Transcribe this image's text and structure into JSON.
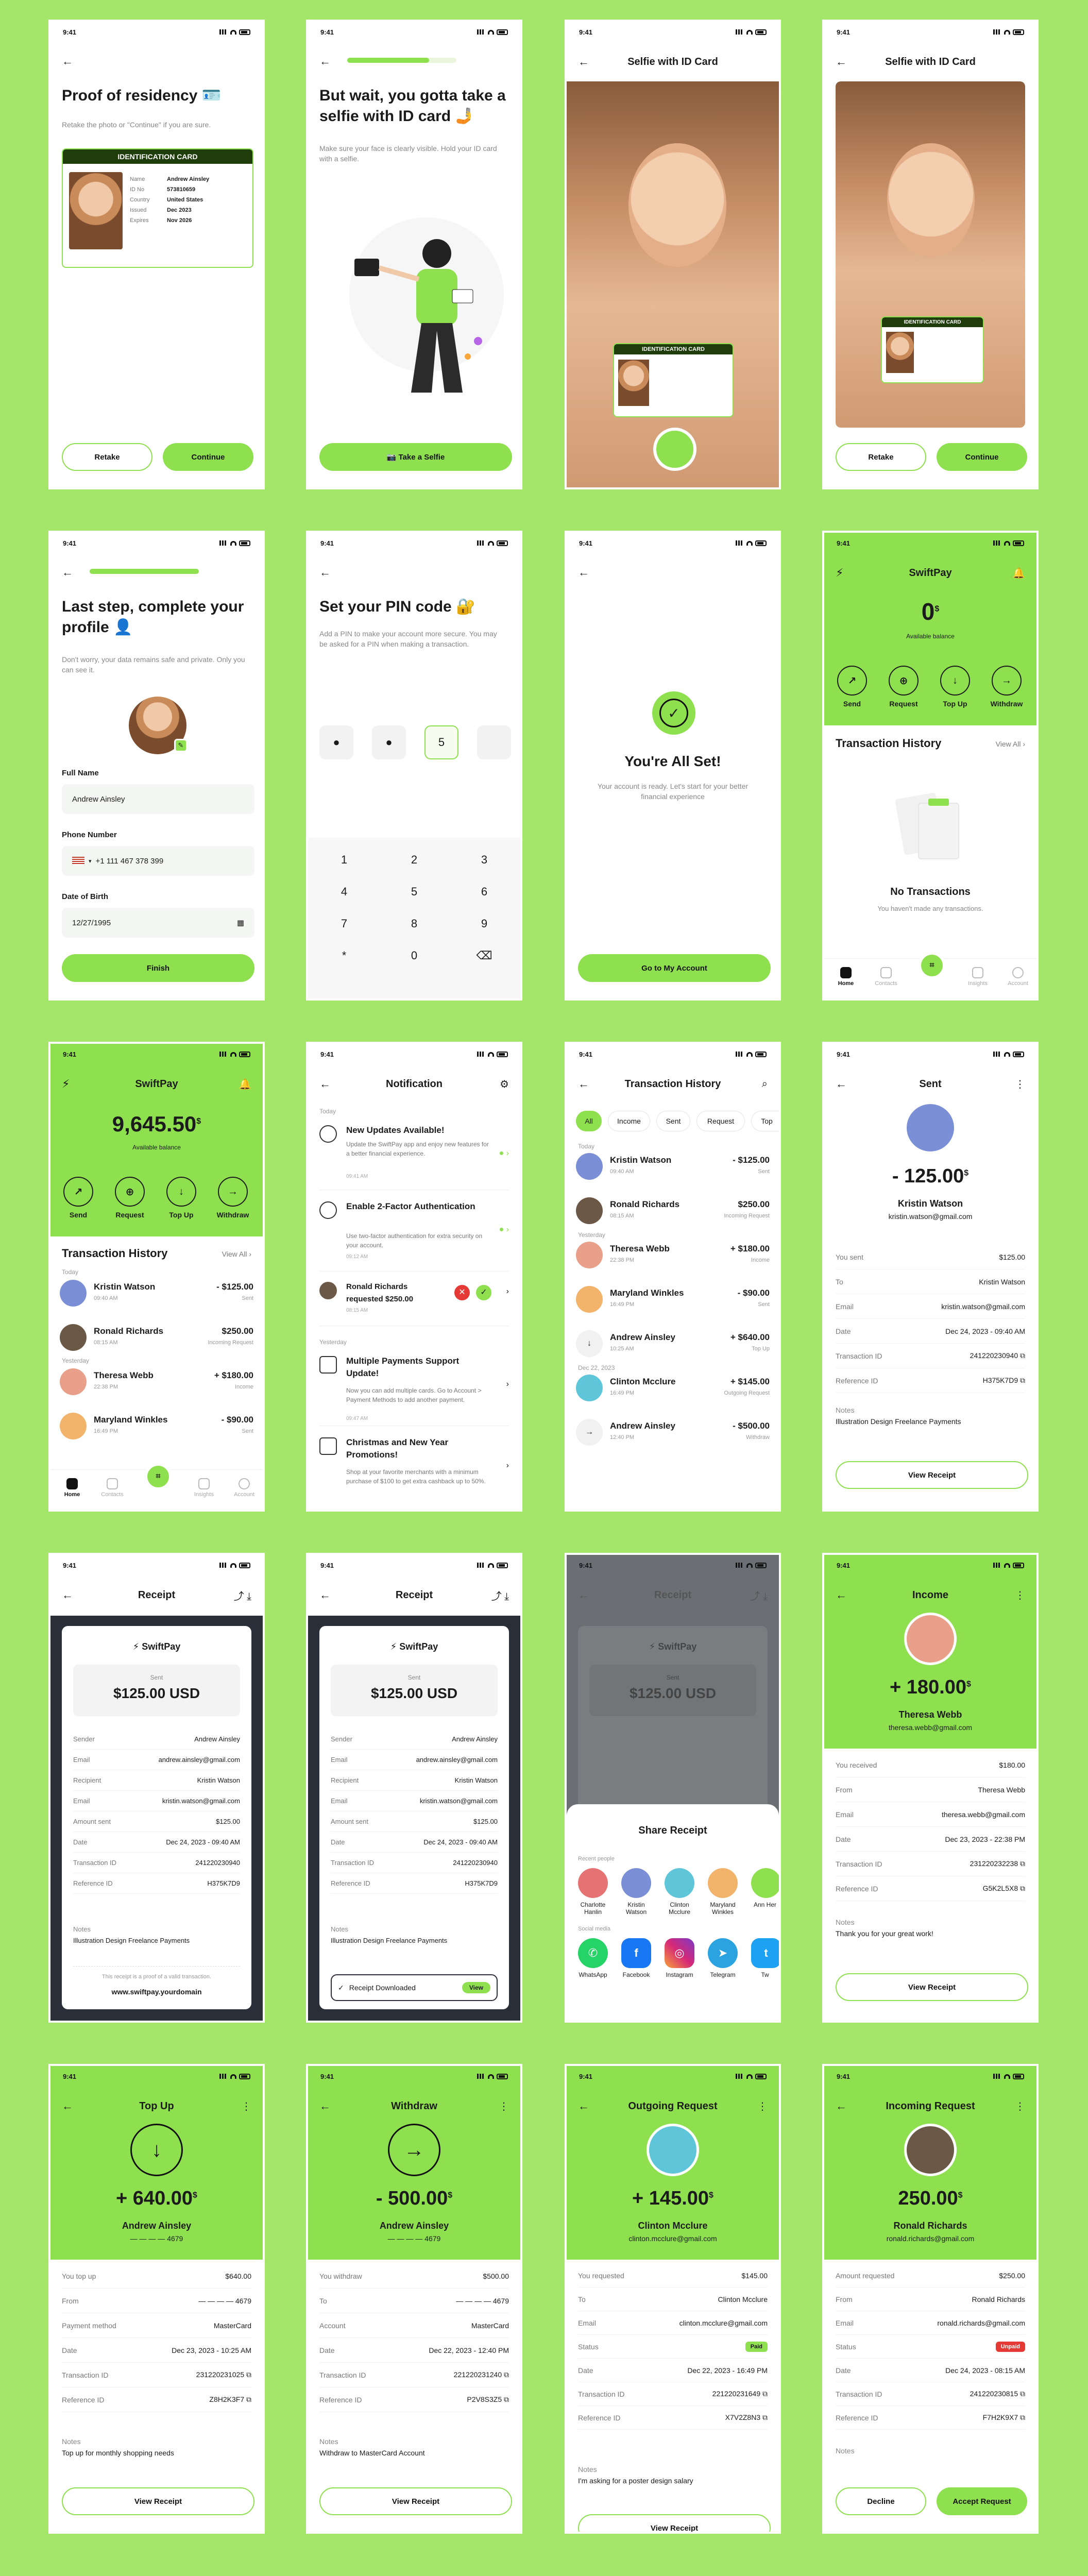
{
  "status_time": "9:41",
  "s1": {
    "title": "Proof of residency 🪪",
    "sub": "Retake the photo or \"Continue\" if you are sure.",
    "card_title": "IDENTIFICATION CARD",
    "rows": [
      [
        "Name",
        "Andrew Ainsley"
      ],
      [
        "ID No",
        "573810659"
      ],
      [
        "Country",
        "United States"
      ],
      [
        "Issued",
        "Dec 2023"
      ],
      [
        "Expires",
        "Nov 2026"
      ]
    ],
    "retake": "Retake",
    "continue": "Continue"
  },
  "s2": {
    "title": "But wait, you gotta take a selfie with ID card 🤳",
    "sub": "Make sure your face is clearly visible. Hold your ID card with a selfie.",
    "btn": "📷  Take a Selfie"
  },
  "s3": {
    "title": "Selfie with ID Card",
    "card_title": "IDENTIFICATION CARD"
  },
  "s4": {
    "title": "Selfie with ID Card",
    "card_title": "IDENTIFICATION CARD",
    "retake": "Retake",
    "continue": "Continue"
  },
  "s5": {
    "title": "Last step, complete your profile 👤",
    "sub": "Don't worry, your data remains safe and private. Only you can see it.",
    "l_name": "Full Name",
    "v_name": "Andrew Ainsley",
    "l_phone": "Phone Number",
    "v_phone": "+1 111 467 378 399",
    "l_dob": "Date of Birth",
    "v_dob": "12/27/1995",
    "btn": "Finish"
  },
  "s6": {
    "title": "Set your PIN code 🔐",
    "sub": "Add a PIN to make your account more secure. You may be asked for a PIN when making a transaction.",
    "pins": [
      "●",
      "●",
      "5",
      ""
    ],
    "keys": [
      "1",
      "2",
      "3",
      "4",
      "5",
      "6",
      "7",
      "8",
      "9",
      "*",
      "0",
      "⌫"
    ]
  },
  "s7": {
    "title": "You're All Set!",
    "sub": "Your account is ready. Let's start for your better financial experience",
    "btn": "Go to My Account"
  },
  "s8": {
    "app": "SwiftPay",
    "balance": "0",
    "currency": "$",
    "bal_label": "Available balance",
    "actions": [
      "Send",
      "Request",
      "Top Up",
      "Withdraw"
    ],
    "section": "Transaction History",
    "view_all": "View All",
    "empty_title": "No Transactions",
    "empty_sub": "You haven't made any transactions.",
    "nav": [
      "Home",
      "Contacts",
      "",
      "Insights",
      "Account"
    ]
  },
  "s9": {
    "app": "SwiftPay",
    "balance": "9,645.50",
    "currency": "$",
    "bal_label": "Available balance",
    "actions": [
      "Send",
      "Request",
      "Top Up",
      "Withdraw"
    ],
    "section": "Transaction History",
    "view_all": "View All",
    "today": "Today",
    "yesterday": "Yesterday",
    "tx": [
      {
        "n": "Kristin Watson",
        "d": "09:40 AM",
        "a": "- $125.00",
        "s": "Sent"
      },
      {
        "n": "Ronald Richards",
        "d": "08:15 AM",
        "a": "$250.00",
        "s": "Incoming Request"
      },
      {
        "n": "Theresa Webb",
        "d": "22:38 PM",
        "a": "+ $180.00",
        "s": "Income"
      },
      {
        "n": "Maryland Winkles",
        "d": "16:49 PM",
        "a": "- $90.00",
        "s": "Sent"
      }
    ],
    "nav": [
      "Home",
      "Contacts",
      "",
      "Insights",
      "Account"
    ]
  },
  "s10": {
    "title": "Notification",
    "today": "Today",
    "yesterday": "Yesterday",
    "items": [
      {
        "t": "New Updates Available!",
        "b": "Update the SwiftPay app and enjoy new features for a better financial experience.",
        "d": "09:41 AM"
      },
      {
        "t": "Enable 2-Factor Authentication",
        "b": "Use two-factor authentication for extra security on your account.",
        "d": "09:12 AM"
      },
      {
        "t": "Ronald Richards requested $250.00",
        "b": "",
        "d": "08:15 AM"
      },
      {
        "t": "Multiple Payments Support Update!",
        "b": "Now you can add multiple cards. Go to Account > Payment Methods to add another payment.",
        "d": "09:47 AM"
      },
      {
        "t": "Christmas and New Year Promotions!",
        "b": "Shop at your favorite merchants with a minimum purchase of $100 to get extra cashback up to 50%.",
        "d": ""
      }
    ]
  },
  "s11": {
    "title": "Transaction History",
    "chips": [
      "All",
      "Income",
      "Sent",
      "Request",
      "Top"
    ],
    "today": "Today",
    "yesterday": "Yesterday",
    "dec22": "Dec 22, 2023",
    "tx": [
      {
        "n": "Kristin Watson",
        "d": "09:40 AM",
        "a": "- $125.00",
        "s": "Sent"
      },
      {
        "n": "Ronald Richards",
        "d": "08:15 AM",
        "a": "$250.00",
        "s": "Incoming Request"
      },
      {
        "n": "Theresa Webb",
        "d": "22:38 PM",
        "a": "+ $180.00",
        "s": "Income"
      },
      {
        "n": "Maryland Winkles",
        "d": "16:49 PM",
        "a": "- $90.00",
        "s": "Sent"
      },
      {
        "n": "Andrew Ainsley",
        "d": "10:25 AM",
        "a": "+ $640.00",
        "s": "Top Up"
      },
      {
        "n": "Clinton Mcclure",
        "d": "16:49 PM",
        "a": "+ $145.00",
        "s": "Outgoing Request"
      },
      {
        "n": "Andrew Ainsley",
        "d": "12:40 PM",
        "a": "- $500.00",
        "s": "Withdraw"
      }
    ]
  },
  "s12": {
    "title": "Sent",
    "amount": "- 125.00",
    "cur": "$",
    "name": "Kristin Watson",
    "email": "kristin.watson@gmail.com",
    "rows": [
      [
        "You sent",
        "$125.00"
      ],
      [
        "To",
        "Kristin Watson"
      ],
      [
        "Email",
        "kristin.watson@gmail.com"
      ],
      [
        "Date",
        "Dec 24, 2023 - 09:40 AM"
      ],
      [
        "Transaction ID",
        "241220230940  ⧉"
      ],
      [
        "Reference ID",
        "H375K7D9  ⧉"
      ]
    ],
    "notes_k": "Notes",
    "notes_v": "Illustration Design Freelance Payments",
    "btn": "View Receipt"
  },
  "receipt": {
    "title": "Receipt",
    "brand": "SwiftPay",
    "sent": "Sent",
    "amount": "$125.00 USD",
    "rows": [
      [
        "Sender",
        "Andrew Ainsley"
      ],
      [
        "Email",
        "andrew.ainsley@gmail.com"
      ],
      [
        "Recipient",
        "Kristin Watson"
      ],
      [
        "Email",
        "kristin.watson@gmail.com"
      ],
      [
        "Amount sent",
        "$125.00"
      ],
      [
        "Date",
        "Dec 24, 2023 - 09:40 AM"
      ],
      [
        "Transaction ID",
        "241220230940"
      ],
      [
        "Reference ID",
        "H375K7D9"
      ]
    ],
    "notes_k": "Notes",
    "notes_v": "Illustration Design Freelance Payments",
    "footer": "This receipt is a proof of a valid transaction.",
    "url": "www.swiftpay.yourdomain",
    "downloaded": "Receipt Downloaded",
    "view": "View"
  },
  "share": {
    "title": "Share Receipt",
    "recent": "Recent people",
    "social": "Social media",
    "people": [
      "Charlotte Hanlin",
      "Kristin Watson",
      "Clinton Mcclure",
      "Maryland Winkles",
      "Ann Her"
    ],
    "apps": [
      "WhatsApp",
      "Facebook",
      "Instagram",
      "Telegram",
      "Tw"
    ]
  },
  "s16": {
    "title": "Income",
    "amount": "+ 180.00",
    "cur": "$",
    "name": "Theresa Webb",
    "email": "theresa.webb@gmail.com",
    "rows": [
      [
        "You received",
        "$180.00"
      ],
      [
        "From",
        "Theresa Webb"
      ],
      [
        "Email",
        "theresa.webb@gmail.com"
      ],
      [
        "Date",
        "Dec 23, 2023 - 22:38 PM"
      ],
      [
        "Transaction ID",
        "231220232238  ⧉"
      ],
      [
        "Reference ID",
        "G5K2L5X8  ⧉"
      ]
    ],
    "notes_k": "Notes",
    "notes_v": "Thank you for your great work!",
    "btn": "View Receipt"
  },
  "s17": {
    "title": "Top Up",
    "amount": "+ 640.00",
    "cur": "$",
    "name": "Andrew Ainsley",
    "email": "— — — — 4679",
    "rows": [
      [
        "You top up",
        "$640.00"
      ],
      [
        "From",
        "— — — — 4679"
      ],
      [
        "Payment method",
        "MasterCard"
      ],
      [
        "Date",
        "Dec 23, 2023 - 10:25 AM"
      ],
      [
        "Transaction ID",
        "231220231025  ⧉"
      ],
      [
        "Reference ID",
        "Z8H2K3F7  ⧉"
      ]
    ],
    "notes_k": "Notes",
    "notes_v": "Top up for monthly shopping needs",
    "btn": "View Receipt"
  },
  "s18": {
    "title": "Withdraw",
    "amount": "- 500.00",
    "cur": "$",
    "name": "Andrew Ainsley",
    "email": "— — — — 4679",
    "rows": [
      [
        "You withdraw",
        "$500.00"
      ],
      [
        "To",
        "— — — — 4679"
      ],
      [
        "Account",
        "MasterCard"
      ],
      [
        "Date",
        "Dec 22, 2023 - 12:40 PM"
      ],
      [
        "Transaction ID",
        "221220231240  ⧉"
      ],
      [
        "Reference ID",
        "P2V8S3Z5  ⧉"
      ]
    ],
    "notes_k": "Notes",
    "notes_v": "Withdraw to MasterCard Account",
    "btn": "View Receipt"
  },
  "s19": {
    "title": "Outgoing Request",
    "amount": "+ 145.00",
    "cur": "$",
    "name": "Clinton Mcclure",
    "email": "clinton.mcclure@gmail.com",
    "rows": [
      [
        "You requested",
        "$145.00"
      ],
      [
        "To",
        "Clinton Mcclure"
      ],
      [
        "Email",
        "clinton.mcclure@gmail.com"
      ],
      [
        "Status",
        "Paid"
      ],
      [
        "Date",
        "Dec 22, 2023 - 16:49 PM"
      ],
      [
        "Transaction ID",
        "221220231649  ⧉"
      ],
      [
        "Reference ID",
        "X7V2Z8N3  ⧉"
      ]
    ],
    "notes_k": "Notes",
    "notes_v": "I'm asking for a poster design salary",
    "btn": "View Receipt"
  },
  "s20": {
    "title": "Incoming Request",
    "amount": "250.00",
    "cur": "$",
    "name": "Ronald Richards",
    "email": "ronald.richards@gmail.com",
    "rows": [
      [
        "Amount requested",
        "$250.00"
      ],
      [
        "From",
        "Ronald Richards"
      ],
      [
        "Email",
        "ronald.richards@gmail.com"
      ],
      [
        "Status",
        "Unpaid"
      ],
      [
        "Date",
        "Dec 24, 2023 - 08:15 AM"
      ],
      [
        "Transaction ID",
        "241220230815  ⧉"
      ],
      [
        "Reference ID",
        "F7H2K9X7  ⧉"
      ]
    ],
    "notes_k": "Notes",
    "decline": "Decline",
    "accept": "Accept Request"
  }
}
